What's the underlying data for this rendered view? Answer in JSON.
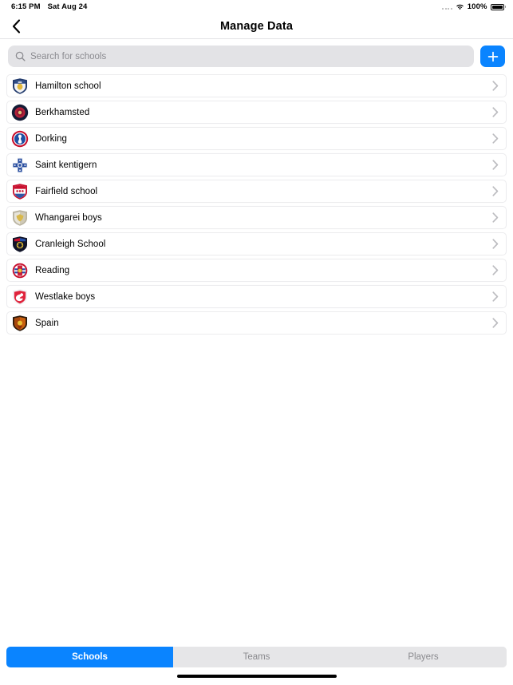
{
  "status_bar": {
    "time": "6:15 PM",
    "date": "Sat Aug 24",
    "battery_percent": "100%",
    "wifi_icon": "wifi-icon",
    "signal_icon": "signal-dots-icon",
    "battery_icon": "battery-full-icon"
  },
  "navbar": {
    "back_icon": "chevron-left-icon",
    "title": "Manage Data"
  },
  "search": {
    "icon": "search-icon",
    "placeholder": "Search for schools",
    "value": "",
    "add_button_icon": "plus-icon",
    "add_button_color": "#0a84ff"
  },
  "list": {
    "disclosure_icon": "chevron-right-icon",
    "items": [
      {
        "label": "Hamilton school",
        "logo": "crest-hamilton-school"
      },
      {
        "label": "Berkhamsted",
        "logo": "crest-berkhamsted"
      },
      {
        "label": "Dorking",
        "logo": "crest-dorking"
      },
      {
        "label": "Saint kentigern",
        "logo": "crest-saint-kentigern"
      },
      {
        "label": "Fairfield school",
        "logo": "crest-fairfield-school"
      },
      {
        "label": "Whangarei boys",
        "logo": "crest-whangarei-boys"
      },
      {
        "label": "Cranleigh School",
        "logo": "crest-cranleigh-school"
      },
      {
        "label": "Reading",
        "logo": "crest-reading"
      },
      {
        "label": "Westlake boys",
        "logo": "crest-westlake-boys"
      },
      {
        "label": "Spain",
        "logo": "crest-spain"
      }
    ]
  },
  "tabs": {
    "selected": "Schools",
    "accent_color": "#0a84ff",
    "items": [
      {
        "label": "Schools",
        "active": true
      },
      {
        "label": "Teams",
        "active": false
      },
      {
        "label": "Players",
        "active": false
      }
    ]
  }
}
